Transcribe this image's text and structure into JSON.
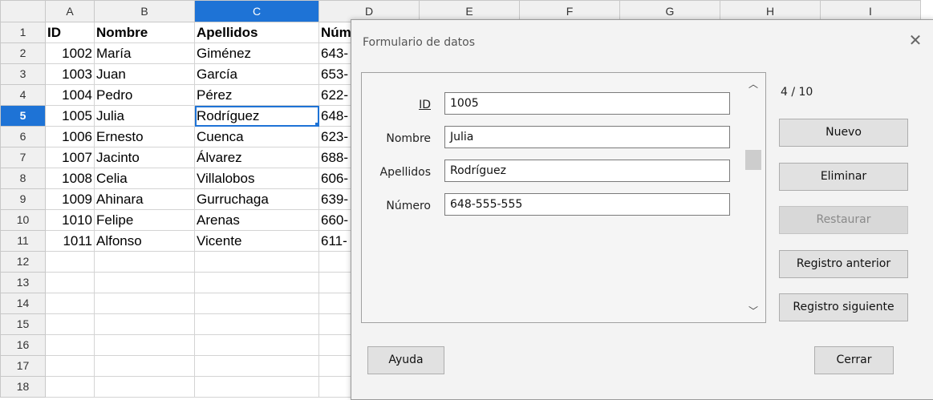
{
  "sheet": {
    "columns": [
      "A",
      "B",
      "C",
      "D",
      "E",
      "F",
      "G",
      "H",
      "I"
    ],
    "selected_column": "C",
    "selected_row": 5,
    "header_row": [
      "ID",
      "Nombre",
      "Apellidos",
      "Núm"
    ],
    "rows": [
      {
        "n": "1",
        "id": "ID",
        "nombre": "Nombre",
        "apellidos": "Apellidos",
        "numero": "Núm"
      },
      {
        "n": "2",
        "id": "1002",
        "nombre": "María",
        "apellidos": "Giménez",
        "numero": "643-"
      },
      {
        "n": "3",
        "id": "1003",
        "nombre": "Juan",
        "apellidos": "García",
        "numero": "653-"
      },
      {
        "n": "4",
        "id": "1004",
        "nombre": "Pedro",
        "apellidos": "Pérez",
        "numero": "622-"
      },
      {
        "n": "5",
        "id": "1005",
        "nombre": "Julia",
        "apellidos": "Rodríguez",
        "numero": "648-"
      },
      {
        "n": "6",
        "id": "1006",
        "nombre": "Ernesto",
        "apellidos": "Cuenca",
        "numero": "623-"
      },
      {
        "n": "7",
        "id": "1007",
        "nombre": "Jacinto",
        "apellidos": "Álvarez",
        "numero": "688-"
      },
      {
        "n": "8",
        "id": "1008",
        "nombre": "Celia",
        "apellidos": "Villalobos",
        "numero": "606-"
      },
      {
        "n": "9",
        "id": "1009",
        "nombre": "Ahinara",
        "apellidos": "Gurruchaga",
        "numero": "639-"
      },
      {
        "n": "10",
        "id": "1010",
        "nombre": "Felipe",
        "apellidos": "Arenas",
        "numero": "660-"
      },
      {
        "n": "11",
        "id": "1011",
        "nombre": "Alfonso",
        "apellidos": "Vicente",
        "numero": "611-"
      },
      {
        "n": "12",
        "id": "",
        "nombre": "",
        "apellidos": "",
        "numero": ""
      },
      {
        "n": "13",
        "id": "",
        "nombre": "",
        "apellidos": "",
        "numero": ""
      },
      {
        "n": "14",
        "id": "",
        "nombre": "",
        "apellidos": "",
        "numero": ""
      },
      {
        "n": "15",
        "id": "",
        "nombre": "",
        "apellidos": "",
        "numero": ""
      },
      {
        "n": "16",
        "id": "",
        "nombre": "",
        "apellidos": "",
        "numero": ""
      },
      {
        "n": "17",
        "id": "",
        "nombre": "",
        "apellidos": "",
        "numero": ""
      },
      {
        "n": "18",
        "id": "",
        "nombre": "",
        "apellidos": "",
        "numero": ""
      }
    ]
  },
  "dialog": {
    "title": "Formulario de datos",
    "close_icon": "close-icon",
    "counter": "4 / 10",
    "fields": [
      {
        "label": "ID",
        "value": "1005"
      },
      {
        "label": "Nombre",
        "value": "Julia"
      },
      {
        "label": "Apellidos",
        "value": "Rodríguez"
      },
      {
        "label": "Número",
        "value": "648-555-555"
      }
    ],
    "buttons": {
      "nuevo": "Nuevo",
      "eliminar": "Eliminar",
      "restaurar": "Restaurar",
      "anterior": "Registro anterior",
      "siguiente": "Registro siguiente",
      "ayuda": "Ayuda",
      "cerrar": "Cerrar"
    },
    "colors": {
      "selection": "#1e73d6",
      "dialog_bg": "#f3f3f3",
      "button_bg": "#e1e1e1"
    }
  }
}
